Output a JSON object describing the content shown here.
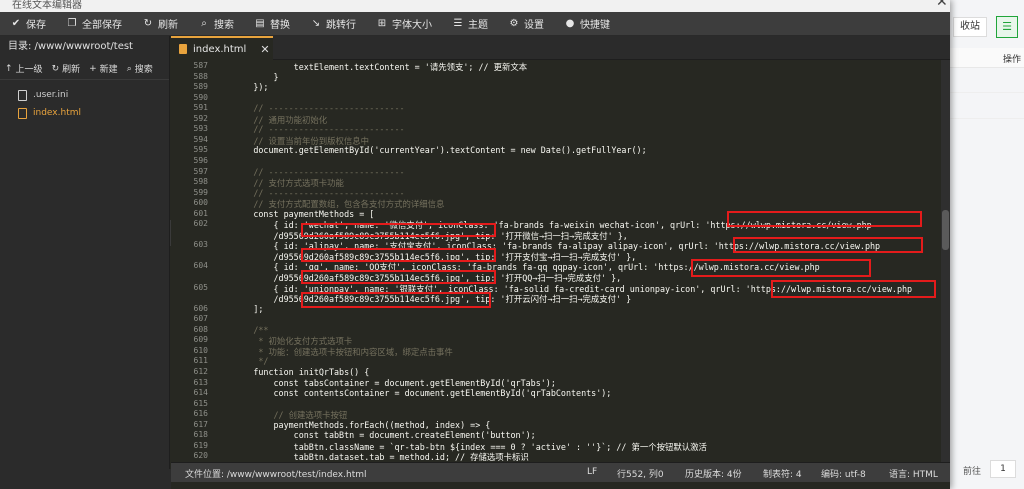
{
  "window": {
    "title": "在线文本编辑器",
    "close_glyph": "✕"
  },
  "toolbar": [
    {
      "id": "save",
      "icon": "✔",
      "label": "保存"
    },
    {
      "id": "save-all",
      "icon": "❐",
      "label": "全部保存"
    },
    {
      "id": "refresh",
      "icon": "↻",
      "label": "刷新"
    },
    {
      "id": "search",
      "icon": "⌕",
      "label": "搜索"
    },
    {
      "id": "replace",
      "icon": "▤",
      "label": "替换"
    },
    {
      "id": "goto-line",
      "icon": "↘",
      "label": "跳转行"
    },
    {
      "id": "font-size",
      "icon": "⊞",
      "label": "字体大小"
    },
    {
      "id": "theme",
      "icon": "☰",
      "label": "主题"
    },
    {
      "id": "settings",
      "icon": "⚙",
      "label": "设置"
    },
    {
      "id": "shortcuts",
      "icon": "●",
      "label": "快捷键"
    }
  ],
  "sidebar": {
    "directory": "目录: /www/wwwroot/test",
    "actions": [
      {
        "id": "up",
        "icon": "↑",
        "label": "上一级"
      },
      {
        "id": "refresh",
        "icon": "↻",
        "label": "刷新"
      },
      {
        "id": "new",
        "icon": "+",
        "label": "新建"
      },
      {
        "id": "search",
        "icon": "⌕",
        "label": "搜索"
      }
    ],
    "files": [
      {
        "name": ".user.ini",
        "type": "ini",
        "active": false
      },
      {
        "name": "index.html",
        "type": "html",
        "active": true
      }
    ],
    "collapse_glyph": "‹"
  },
  "tabs": [
    {
      "label": "index.html",
      "close": "✕"
    }
  ],
  "code": {
    "first_line_number": 587,
    "lines": [
      {
        "n": "587",
        "text": "                textElement.textContent = '请先领支'; // 更新文本"
      },
      {
        "n": "588",
        "text": "            }"
      },
      {
        "n": "589",
        "text": "        });"
      },
      {
        "n": "590",
        "text": ""
      },
      {
        "n": "591",
        "text": "        // ---------------------------"
      },
      {
        "n": "592",
        "text": "        // 通用功能初始化"
      },
      {
        "n": "593",
        "text": "        // ---------------------------"
      },
      {
        "n": "594",
        "text": "        // 设置当前年份到版权信息中"
      },
      {
        "n": "595",
        "text": "        document.getElementById('currentYear').textContent = new Date().getFullYear();"
      },
      {
        "n": "596",
        "text": ""
      },
      {
        "n": "597",
        "text": "        // ---------------------------"
      },
      {
        "n": "598",
        "text": "        // 支付方式选项卡功能"
      },
      {
        "n": "599",
        "text": "        // ---------------------------"
      },
      {
        "n": "600",
        "text": "        // 支付方式配置数组，包含各支付方式的详细信息"
      },
      {
        "n": "601",
        "text": "        const paymentMethods = ["
      },
      {
        "n": "602",
        "text": "            { id: 'wechat', name: '微信支付', iconClass: 'fa-brands fa-weixin wechat-icon', qrUrl: 'https://wlwp.mistora.cc/view.php"
      },
      {
        "n": "",
        "text": "            /d95569d260af589c89c3755b114ec5f6.jpg', tip: '打开微信→扫一扫→完成支付' },"
      },
      {
        "n": "603",
        "text": "            { id: 'alipay', name: '支付宝支付', iconClass: 'fa-brands fa-alipay alipay-icon', qrUrl: 'https://wlwp.mistora.cc/view.php"
      },
      {
        "n": "",
        "text": "            /d95569d260af589c89c3755b114ec5f6.jpg', tip: '打开支付宝→扫一扫→完成支付' },"
      },
      {
        "n": "604",
        "text": "            { id: 'qq', name: 'QQ支付', iconClass: 'fa-brands fa-qq qqpay-icon', qrUrl: 'https://wlwp.mistora.cc/view.php"
      },
      {
        "n": "",
        "text": "            /d95569d260af589c89c3755b114ec5f6.jpg', tip: '打开QQ→扫一扫→完成支付' },"
      },
      {
        "n": "605",
        "text": "            { id: 'unionpay', name: '银联支付', iconClass: 'fa-solid fa-credit-card unionpay-icon', qrUrl: 'https://wlwp.mistora.cc/view.php"
      },
      {
        "n": "",
        "text": "            /d95569d260af589c89c3755b114ec5f6.jpg', tip: '打开云闪付→扫一扫→完成支付' }"
      },
      {
        "n": "606",
        "text": "        ];"
      },
      {
        "n": "607",
        "text": ""
      },
      {
        "n": "608",
        "text": "        /**"
      },
      {
        "n": "609",
        "text": "         * 初始化支付方式选项卡"
      },
      {
        "n": "610",
        "text": "         * 功能：创建选项卡按钮和内容区域，绑定点击事件"
      },
      {
        "n": "611",
        "text": "         */"
      },
      {
        "n": "612",
        "text": "        function initQrTabs() {"
      },
      {
        "n": "613",
        "text": "            const tabsContainer = document.getElementById('qrTabs');"
      },
      {
        "n": "614",
        "text": "            const contentsContainer = document.getElementById('qrTabContents');"
      },
      {
        "n": "615",
        "text": ""
      },
      {
        "n": "616",
        "text": "            // 创建选项卡按钮"
      },
      {
        "n": "617",
        "text": "            paymentMethods.forEach((method, index) => {"
      },
      {
        "n": "618",
        "text": "                const tabBtn = document.createElement('button');"
      },
      {
        "n": "619",
        "text": "                tabBtn.className = `qr-tab-btn ${index === 0 ? 'active' : ''}`; // 第一个按钮默认激活"
      },
      {
        "n": "620",
        "text": "                tabBtn.dataset.tab = method.id; // 存储选项卡标识"
      }
    ]
  },
  "statusbar": {
    "file_path": "文件位置: /www/wwwroot/test/index.html",
    "line_ending": "LF",
    "cursor": "行552, 列0",
    "history": "历史版本: 4份",
    "tab_size": "制表符: 4",
    "encoding": "编码: utf-8",
    "language": "语言: HTML"
  },
  "background_page": {
    "button_label": "收站",
    "column_header": "操作",
    "page_label": "前往",
    "page_value": "1"
  }
}
